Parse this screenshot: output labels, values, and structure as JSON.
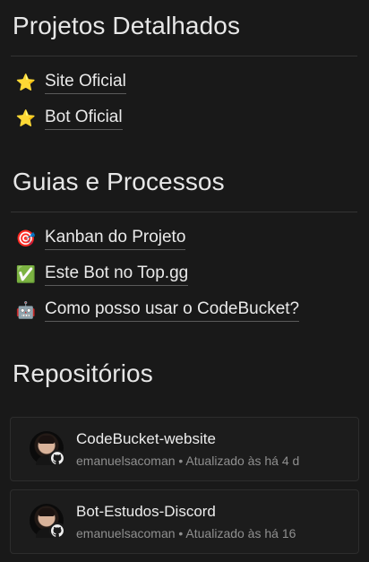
{
  "sections": {
    "projects_title": "Projetos Detalhados",
    "guides_title": "Guias e Processos",
    "repos_title": "Repositórios"
  },
  "project_links": [
    {
      "icon": "star-icon",
      "emoji": "⭐",
      "label": "Site Oficial"
    },
    {
      "icon": "star-icon",
      "emoji": "⭐",
      "label": "Bot Oficial"
    }
  ],
  "guide_links": [
    {
      "icon": "target-icon",
      "emoji": "🎯",
      "label": "Kanban do Projeto"
    },
    {
      "icon": "check-mark-icon",
      "emoji": "✅",
      "label": "Este Bot no Top.gg"
    },
    {
      "icon": "robot-icon",
      "emoji": "🤖",
      "label": "Como posso usar o CodeBucket?"
    }
  ],
  "repositories": [
    {
      "name": "CodeBucket-website",
      "meta": "emanuelsacoman • Atualizado às há 4 d"
    },
    {
      "name": "Bot-Estudos-Discord",
      "meta": "emanuelsacoman • Atualizado às há 16"
    }
  ],
  "colors": {
    "background": "#191919",
    "text": "#e6e6e6",
    "muted": "#8f8f8f",
    "divider": "#333333"
  }
}
